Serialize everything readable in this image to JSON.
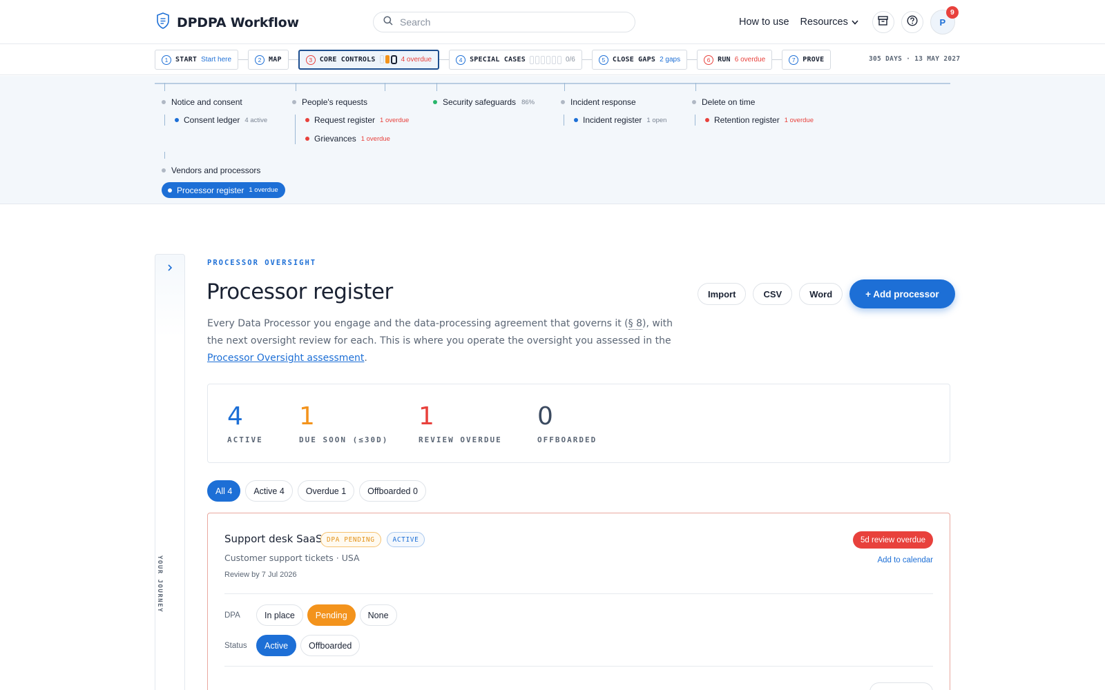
{
  "app": {
    "title": "DPDPA Workflow"
  },
  "search": {
    "placeholder": "Search"
  },
  "nav": {
    "how_to_use": "How to use",
    "resources": "Resources",
    "avatar_initial": "P",
    "notification_count": "9"
  },
  "steps": [
    {
      "num": "1",
      "label": "START",
      "extra": "Start here"
    },
    {
      "num": "2",
      "label": "MAP"
    },
    {
      "num": "3",
      "label": "CORE CONTROLS",
      "extra": "4 overdue",
      "progress": 0.25
    },
    {
      "num": "4",
      "label": "SPECIAL CASES",
      "extra": "0/6"
    },
    {
      "num": "5",
      "label": "CLOSE GAPS",
      "extra": "2 gaps"
    },
    {
      "num": "6",
      "label": "RUN",
      "extra": "6 overdue"
    },
    {
      "num": "7",
      "label": "PROVE"
    }
  ],
  "deadline": "305 DAYS · 13 MAY 2027",
  "journey": {
    "notice": {
      "label": "Notice and consent",
      "subs": [
        {
          "label": "Consent ledger",
          "meta": "4 active"
        }
      ]
    },
    "requests": {
      "label": "People's requests",
      "subs": [
        {
          "label": "Request register",
          "meta": "1 overdue"
        },
        {
          "label": "Grievances",
          "meta": "1 overdue"
        }
      ]
    },
    "security": {
      "label": "Security safeguards",
      "meta": "86%"
    },
    "incident": {
      "label": "Incident response",
      "subs": [
        {
          "label": "Incident register",
          "meta": "1 open"
        }
      ]
    },
    "delete": {
      "label": "Delete on time",
      "subs": [
        {
          "label": "Retention register",
          "meta": "1 overdue"
        }
      ]
    },
    "vendors": {
      "label": "Vendors and processors",
      "subs": [
        {
          "label": "Processor register",
          "meta": "1 overdue"
        }
      ]
    }
  },
  "rail": {
    "label": "YOUR JOURNEY"
  },
  "page": {
    "eyebrow": "PROCESSOR OVERSIGHT",
    "title": "Processor register",
    "desc_part1": "Every Data Processor you engage and the data-processing agreement that governs it (",
    "desc_section": "§ 8",
    "desc_part2": "), with the next oversight review for each. This is where you operate the oversight you assessed in the ",
    "desc_link": "Processor Oversight assessment",
    "desc_end": ".",
    "actions": {
      "import": "Import",
      "csv": "CSV",
      "word": "Word",
      "add": "+ Add processor"
    }
  },
  "stats": [
    {
      "value": "4",
      "label": "ACTIVE",
      "color": "#1d6fd6"
    },
    {
      "value": "1",
      "label": "DUE SOON (≤30D)",
      "color": "#f3931c"
    },
    {
      "value": "1",
      "label": "REVIEW OVERDUE",
      "color": "#e8413c"
    },
    {
      "value": "0",
      "label": "OFFBOARDED",
      "color": "#3b4a60"
    }
  ],
  "filters": [
    "All 4",
    "Active 4",
    "Overdue 1",
    "Offboarded 0"
  ],
  "card": {
    "name": "Support desk SaaS",
    "tag_dpa": "DPA PENDING",
    "tag_status": "ACTIVE",
    "subtitle": "Customer support tickets · USA",
    "review": "Review by 7 Jul 2026",
    "overdue": "5d review overdue",
    "calendar": "Add to calendar",
    "dpa_label": "DPA",
    "dpa_options": [
      "In place",
      "Pending",
      "None"
    ],
    "status_label": "Status",
    "status_options": [
      "Active",
      "Offboarded"
    ]
  }
}
